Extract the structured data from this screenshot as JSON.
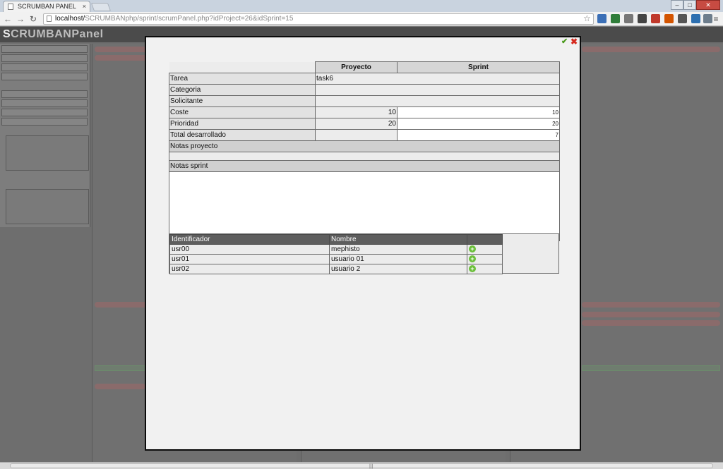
{
  "browser": {
    "tab_title": "SCRUMBAN PANEL",
    "tab_close": "×",
    "url_host": "localhost/",
    "url_path": "SCRUMBANphp/sprint/scrumPanel.php?idProject=26&idSprint=15",
    "window_min": "–",
    "window_max": "□",
    "window_close": "✕",
    "nav_back": "←",
    "nav_forward": "→",
    "nav_reload": "↻",
    "bookmark_star": "☆",
    "menu_icon": "≡",
    "grip": "|||"
  },
  "app": {
    "brand_first": "S",
    "brand_rest": "CRUMBANPanel"
  },
  "modal": {
    "ok_icon": "✔",
    "close_icon": "✖",
    "header": {
      "col_project": "Proyecto",
      "col_sprint": "Sprint"
    },
    "rows": {
      "tarea": {
        "label": "Tarea",
        "project": "task6"
      },
      "categoria": {
        "label": "Categoria",
        "project": ""
      },
      "solicitante": {
        "label": "Solicitante",
        "project": ""
      },
      "coste": {
        "label": "Coste",
        "project": "10",
        "sprint": "10"
      },
      "prioridad": {
        "label": "Prioridad",
        "project": "20",
        "sprint": "20"
      },
      "total": {
        "label": "Total desarrollado",
        "project": "",
        "sprint": "7"
      }
    },
    "notas_proyecto_label": "Notas proyecto",
    "notas_proyecto_value": "",
    "notas_sprint_label": "Notas sprint",
    "notas_sprint_value": "",
    "users": {
      "col_id": "Identificador",
      "col_name": "Nombre",
      "add_symbol": "+",
      "rows": [
        {
          "id": "usr00",
          "name": "mephisto"
        },
        {
          "id": "usr01",
          "name": "usuario 01"
        },
        {
          "id": "usr02",
          "name": "usuario 2"
        }
      ]
    }
  }
}
